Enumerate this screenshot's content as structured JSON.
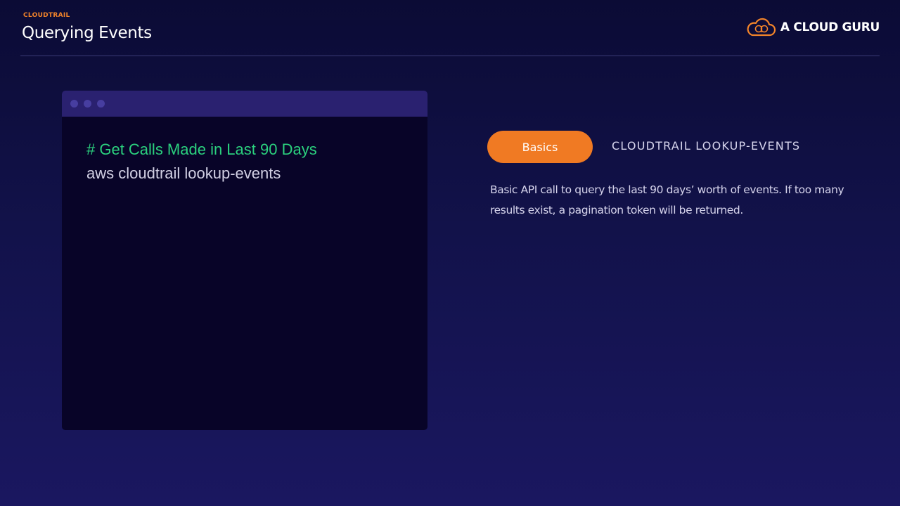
{
  "header": {
    "eyebrow": "CLOUDTRAIL",
    "title": "Querying Events"
  },
  "brand": {
    "name": "A CLOUD GURU",
    "icon": "cloud-logo-icon",
    "color": "#f2842a"
  },
  "terminal": {
    "comment": "# Get Calls Made in Last 90 Days",
    "command": "aws cloudtrail lookup-events",
    "comment_color": "#2bd17e"
  },
  "panel": {
    "button_label": "Basics",
    "button_color": "#f07a23",
    "command_title": "CLOUDTRAIL LOOKUP-EVENTS",
    "description": "Basic API call to query the last 90 days’ worth of events. If too many results exist, a pagination token will be returned."
  }
}
